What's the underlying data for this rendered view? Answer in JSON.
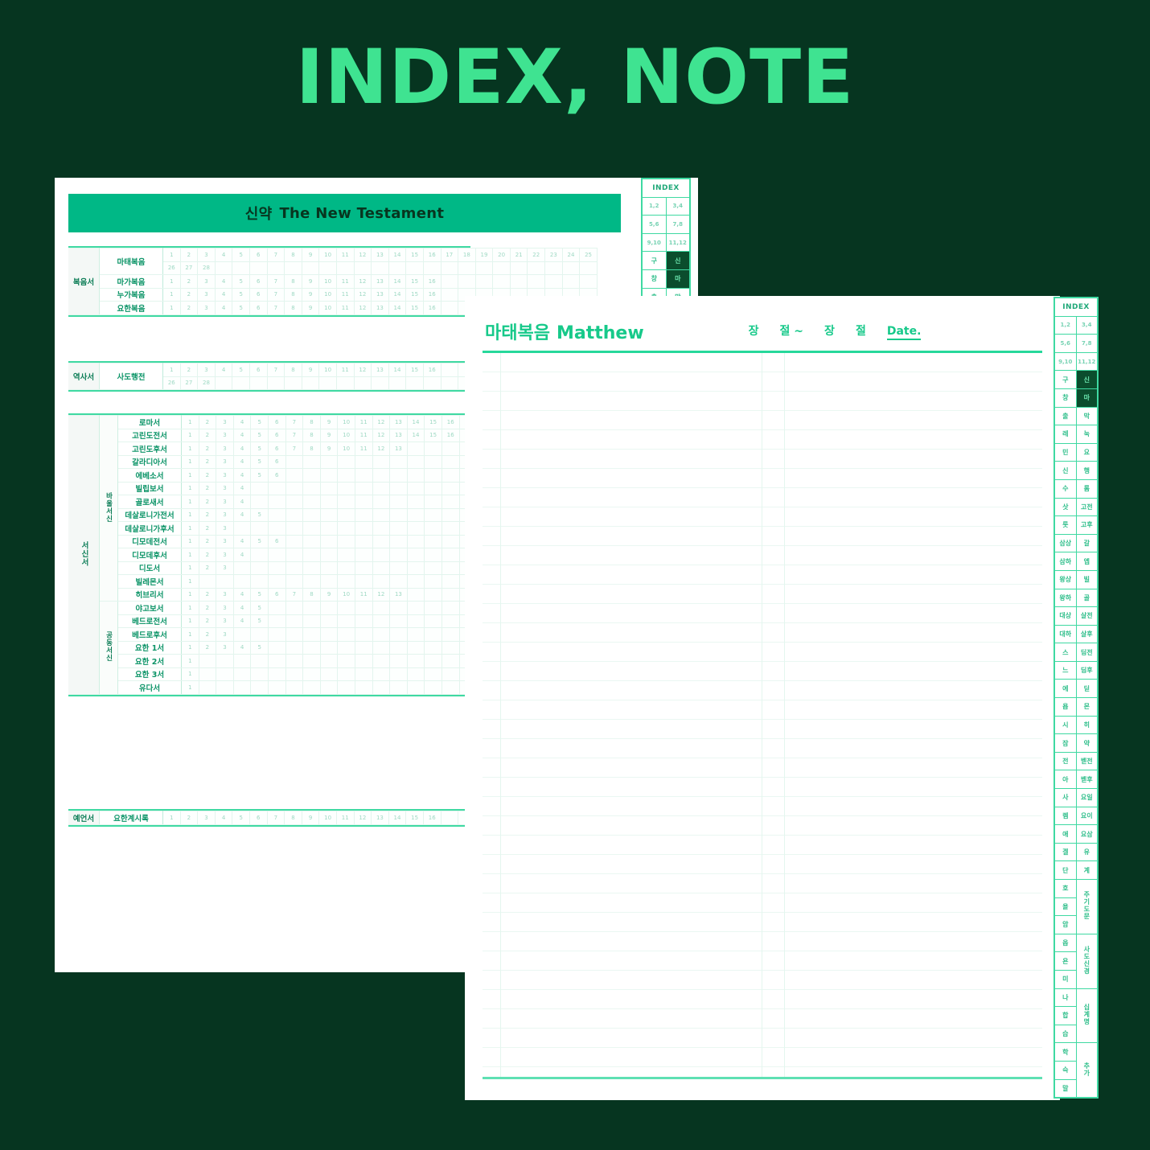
{
  "poster": {
    "title": "INDEX, NOTE",
    "accent": "#3FE391",
    "background": "#063520"
  },
  "index_page": {
    "banner": {
      "kr": "신약",
      "en": "The New Testament"
    },
    "sections": [
      {
        "group": "복음서",
        "books": [
          {
            "name": "마태복음",
            "rows": [
              [
                "1",
                "2",
                "3",
                "4",
                "5",
                "6",
                "7",
                "8",
                "9",
                "10",
                "11",
                "12",
                "13",
                "14",
                "15",
                "16",
                "17",
                "18",
                "19",
                "20",
                "21",
                "22",
                "23",
                "24",
                "25"
              ],
              [
                "26",
                "27",
                "28"
              ]
            ]
          },
          {
            "name": "마가복음",
            "rows": [
              [
                "1",
                "2",
                "3",
                "4",
                "5",
                "6",
                "7",
                "8",
                "9",
                "10",
                "11",
                "12",
                "13",
                "14",
                "15",
                "16"
              ]
            ]
          },
          {
            "name": "누가복음",
            "rows": [
              [
                "1",
                "2",
                "3",
                "4",
                "5",
                "6",
                "7",
                "8",
                "9",
                "10",
                "11",
                "12",
                "13",
                "14",
                "15",
                "16"
              ]
            ]
          },
          {
            "name": "요한복음",
            "rows": [
              [
                "1",
                "2",
                "3",
                "4",
                "5",
                "6",
                "7",
                "8",
                "9",
                "10",
                "11",
                "12",
                "13",
                "14",
                "15",
                "16"
              ]
            ]
          }
        ]
      },
      {
        "group": "역사서",
        "books": [
          {
            "name": "사도행전",
            "rows": [
              [
                "1",
                "2",
                "3",
                "4",
                "5",
                "6",
                "7",
                "8",
                "9",
                "10",
                "11",
                "12",
                "13",
                "14",
                "15",
                "16"
              ],
              [
                "26",
                "27",
                "28"
              ]
            ]
          }
        ]
      },
      {
        "group": "서신서",
        "subgroups": [
          {
            "label": "바울서신",
            "books": [
              {
                "name": "로마서",
                "rows": [
                  [
                    "1",
                    "2",
                    "3",
                    "4",
                    "5",
                    "6",
                    "7",
                    "8",
                    "9",
                    "10",
                    "11",
                    "12",
                    "13",
                    "14",
                    "15",
                    "16"
                  ]
                ]
              },
              {
                "name": "고린도전서",
                "rows": [
                  [
                    "1",
                    "2",
                    "3",
                    "4",
                    "5",
                    "6",
                    "7",
                    "8",
                    "9",
                    "10",
                    "11",
                    "12",
                    "13",
                    "14",
                    "15",
                    "16"
                  ]
                ]
              },
              {
                "name": "고린도후서",
                "rows": [
                  [
                    "1",
                    "2",
                    "3",
                    "4",
                    "5",
                    "6",
                    "7",
                    "8",
                    "9",
                    "10",
                    "11",
                    "12",
                    "13"
                  ]
                ]
              },
              {
                "name": "갈라디아서",
                "rows": [
                  [
                    "1",
                    "2",
                    "3",
                    "4",
                    "5",
                    "6"
                  ]
                ]
              },
              {
                "name": "에베소서",
                "rows": [
                  [
                    "1",
                    "2",
                    "3",
                    "4",
                    "5",
                    "6"
                  ]
                ]
              },
              {
                "name": "빌립보서",
                "rows": [
                  [
                    "1",
                    "2",
                    "3",
                    "4"
                  ]
                ]
              },
              {
                "name": "골로새서",
                "rows": [
                  [
                    "1",
                    "2",
                    "3",
                    "4"
                  ]
                ]
              },
              {
                "name": "데살로니가전서",
                "rows": [
                  [
                    "1",
                    "2",
                    "3",
                    "4",
                    "5"
                  ]
                ]
              },
              {
                "name": "데살로니가후서",
                "rows": [
                  [
                    "1",
                    "2",
                    "3"
                  ]
                ]
              },
              {
                "name": "디모데전서",
                "rows": [
                  [
                    "1",
                    "2",
                    "3",
                    "4",
                    "5",
                    "6"
                  ]
                ]
              },
              {
                "name": "디모데후서",
                "rows": [
                  [
                    "1",
                    "2",
                    "3",
                    "4"
                  ]
                ]
              },
              {
                "name": "디도서",
                "rows": [
                  [
                    "1",
                    "2",
                    "3"
                  ]
                ]
              },
              {
                "name": "빌레몬서",
                "rows": [
                  [
                    "1"
                  ]
                ]
              },
              {
                "name": "히브리서",
                "rows": [
                  [
                    "1",
                    "2",
                    "3",
                    "4",
                    "5",
                    "6",
                    "7",
                    "8",
                    "9",
                    "10",
                    "11",
                    "12",
                    "13"
                  ]
                ]
              }
            ]
          },
          {
            "label": "공동서신",
            "books": [
              {
                "name": "야고보서",
                "rows": [
                  [
                    "1",
                    "2",
                    "3",
                    "4",
                    "5"
                  ]
                ]
              },
              {
                "name": "베드로전서",
                "rows": [
                  [
                    "1",
                    "2",
                    "3",
                    "4",
                    "5"
                  ]
                ]
              },
              {
                "name": "베드로후서",
                "rows": [
                  [
                    "1",
                    "2",
                    "3"
                  ]
                ]
              },
              {
                "name": "요한 1서",
                "rows": [
                  [
                    "1",
                    "2",
                    "3",
                    "4",
                    "5"
                  ]
                ]
              },
              {
                "name": "요한 2서",
                "rows": [
                  [
                    "1"
                  ]
                ]
              },
              {
                "name": "요한 3서",
                "rows": [
                  [
                    "1"
                  ]
                ]
              },
              {
                "name": "유다서",
                "rows": [
                  [
                    "1"
                  ]
                ]
              }
            ]
          }
        ]
      },
      {
        "group": "예언서",
        "books": [
          {
            "name": "요한계시록",
            "rows": [
              [
                "1",
                "2",
                "3",
                "4",
                "5",
                "6",
                "7",
                "8",
                "9",
                "10",
                "11",
                "12",
                "13",
                "14",
                "15",
                "16"
              ]
            ]
          }
        ]
      }
    ]
  },
  "note_page": {
    "title_kr": "마태복음",
    "title_en": "Matthew",
    "meta": {
      "chapter1": "장",
      "verse1": "절 ~",
      "chapter2": "장",
      "verse2": "절",
      "date": "Date."
    },
    "line_count": 37
  },
  "index_tab": {
    "header": "INDEX",
    "number_rows": [
      [
        "1,2",
        "3,4"
      ],
      [
        "5,6",
        "7,8"
      ],
      [
        "9,10",
        "11,12"
      ]
    ],
    "testament_row": {
      "left": "구",
      "right": "신",
      "active": "right"
    },
    "book_rows": [
      {
        "left": "창",
        "right": "마",
        "active": "right"
      },
      {
        "left": "출",
        "right": "막"
      },
      {
        "left": "레",
        "right": "눅"
      },
      {
        "left": "민",
        "right": "요"
      },
      {
        "left": "신",
        "right": "행"
      },
      {
        "left": "수",
        "right": "롬"
      },
      {
        "left": "삿",
        "right": "고전"
      },
      {
        "left": "룻",
        "right": "고후"
      },
      {
        "left": "삼상",
        "right": "갈"
      },
      {
        "left": "삼하",
        "right": "엡"
      },
      {
        "left": "왕상",
        "right": "빌"
      },
      {
        "left": "왕하",
        "right": "골"
      },
      {
        "left": "대상",
        "right": "살전"
      },
      {
        "left": "대하",
        "right": "살후"
      },
      {
        "left": "스",
        "right": "딤전"
      },
      {
        "left": "느",
        "right": "딤후"
      },
      {
        "left": "에",
        "right": "딛"
      },
      {
        "left": "욥",
        "right": "몬"
      },
      {
        "left": "시",
        "right": "히"
      },
      {
        "left": "잠",
        "right": "약"
      },
      {
        "left": "전",
        "right": "벧전"
      },
      {
        "left": "아",
        "right": "벧후"
      },
      {
        "left": "사",
        "right": "요일"
      },
      {
        "left": "렘",
        "right": "요이"
      },
      {
        "left": "애",
        "right": "요삼"
      },
      {
        "left": "겔",
        "right": "유"
      },
      {
        "left": "단",
        "right": "계"
      },
      {
        "left": "호",
        "right": "주기도문",
        "span": 3
      },
      {
        "left": "욜"
      },
      {
        "left": "암"
      },
      {
        "left": "옵",
        "right": "사도신경",
        "span": 3
      },
      {
        "left": "욘"
      },
      {
        "left": "미"
      },
      {
        "left": "나",
        "right": "십계명",
        "span": 3
      },
      {
        "left": "합"
      },
      {
        "left": "습"
      },
      {
        "left": "학",
        "right": "추가",
        "span": 3
      },
      {
        "left": "슥"
      },
      {
        "left": "말"
      }
    ]
  }
}
